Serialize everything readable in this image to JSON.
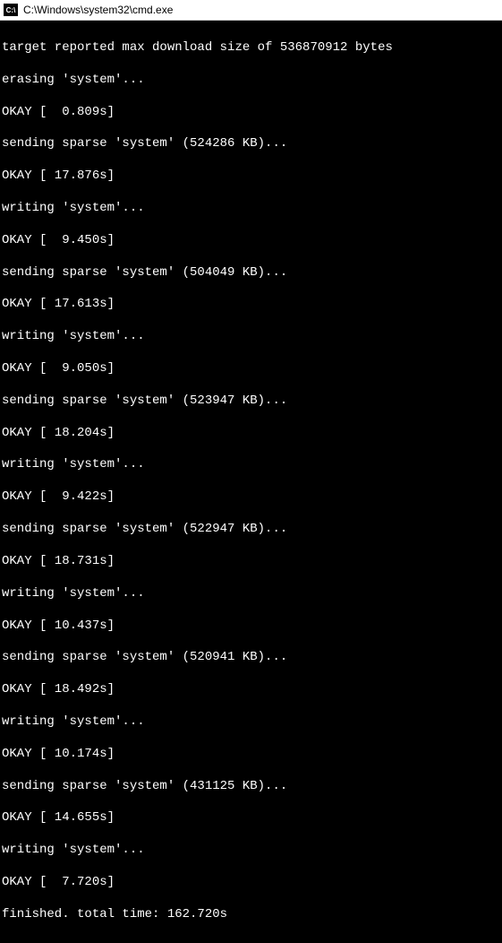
{
  "window": {
    "icon_label": "C:\\",
    "title": "C:\\Windows\\system32\\cmd.exe"
  },
  "lines": [
    "target reported max download size of 536870912 bytes",
    "erasing 'system'...",
    "OKAY [  0.809s]",
    "sending sparse 'system' (524286 KB)...",
    "OKAY [ 17.876s]",
    "writing 'system'...",
    "OKAY [  9.450s]",
    "sending sparse 'system' (504049 KB)...",
    "OKAY [ 17.613s]",
    "writing 'system'...",
    "OKAY [  9.050s]",
    "sending sparse 'system' (523947 KB)...",
    "OKAY [ 18.204s]",
    "writing 'system'...",
    "OKAY [  9.422s]",
    "sending sparse 'system' (522947 KB)...",
    "OKAY [ 18.731s]",
    "writing 'system'...",
    "OKAY [ 10.437s]",
    "sending sparse 'system' (520941 KB)...",
    "OKAY [ 18.492s]",
    "writing 'system'...",
    "OKAY [ 10.174s]",
    "sending sparse 'system' (431125 KB)...",
    "OKAY [ 14.655s]",
    "writing 'system'...",
    "OKAY [  7.720s]",
    "finished. total time: 162.720s"
  ]
}
